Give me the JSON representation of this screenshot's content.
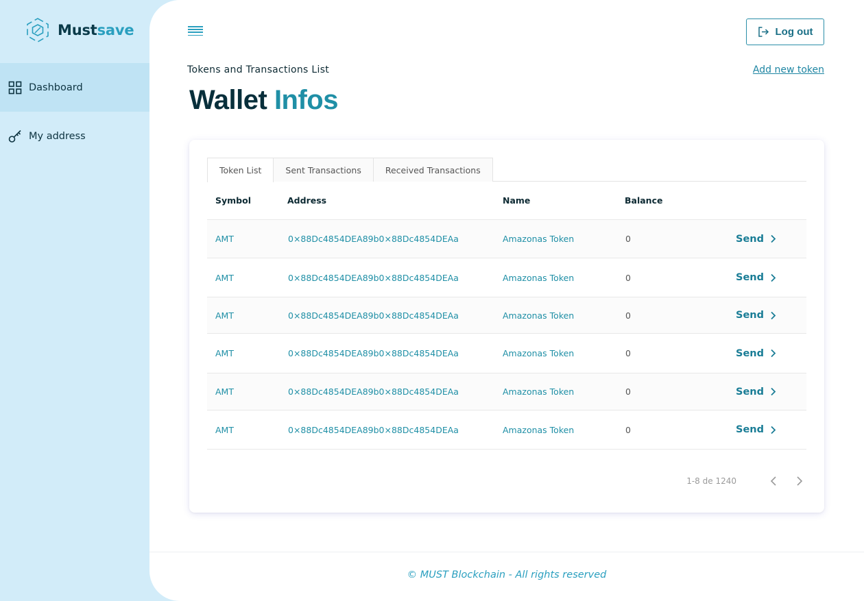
{
  "brand": {
    "must": "Must",
    "save": "save"
  },
  "sidebar": {
    "items": [
      {
        "label": "Dashboard",
        "icon": "grid-icon",
        "active": true
      },
      {
        "label": "My address",
        "icon": "key-icon",
        "active": false
      }
    ]
  },
  "header": {
    "logout_label": "Log out"
  },
  "page": {
    "subtitle": "Tokens and Transactions List",
    "add_token_label": "Add new token",
    "title_dark": "Wallet",
    "title_accent": "Infos"
  },
  "tabs": [
    {
      "label": "Token List",
      "active": true
    },
    {
      "label": "Sent Transactions",
      "active": false
    },
    {
      "label": "Received Transactions",
      "active": false
    }
  ],
  "table": {
    "columns": [
      "Symbol",
      "Address",
      "Name",
      "Balance"
    ],
    "rows": [
      {
        "symbol": "AMT",
        "address": "0×88Dc4854DEA89b0×88Dc4854DEAa",
        "name": "Amazonas Token",
        "balance": "0",
        "action": "Send"
      },
      {
        "symbol": "AMT",
        "address": "0×88Dc4854DEA89b0×88Dc4854DEAa",
        "name": "Amazonas Token",
        "balance": "0",
        "action": "Send"
      },
      {
        "symbol": "AMT",
        "address": "0×88Dc4854DEA89b0×88Dc4854DEAa",
        "name": "Amazonas Token",
        "balance": "0",
        "action": "Send"
      },
      {
        "symbol": "AMT",
        "address": "0×88Dc4854DEA89b0×88Dc4854DEAa",
        "name": "Amazonas Token",
        "balance": "0",
        "action": "Send"
      },
      {
        "symbol": "AMT",
        "address": "0×88Dc4854DEA89b0×88Dc4854DEAa",
        "name": "Amazonas Token",
        "balance": "0",
        "action": "Send"
      },
      {
        "symbol": "AMT",
        "address": "0×88Dc4854DEA89b0×88Dc4854DEAa",
        "name": "Amazonas Token",
        "balance": "0",
        "action": "Send"
      }
    ]
  },
  "pagination": {
    "text": "1-8 de 1240"
  },
  "footer": {
    "text": "© MUST Blockchain - All rights reserved"
  },
  "colors": {
    "sidebar_bg": "#d2ecf9",
    "sidebar_active": "#bfe3f4",
    "accent": "#1f8fa6",
    "dark": "#082f3b"
  }
}
